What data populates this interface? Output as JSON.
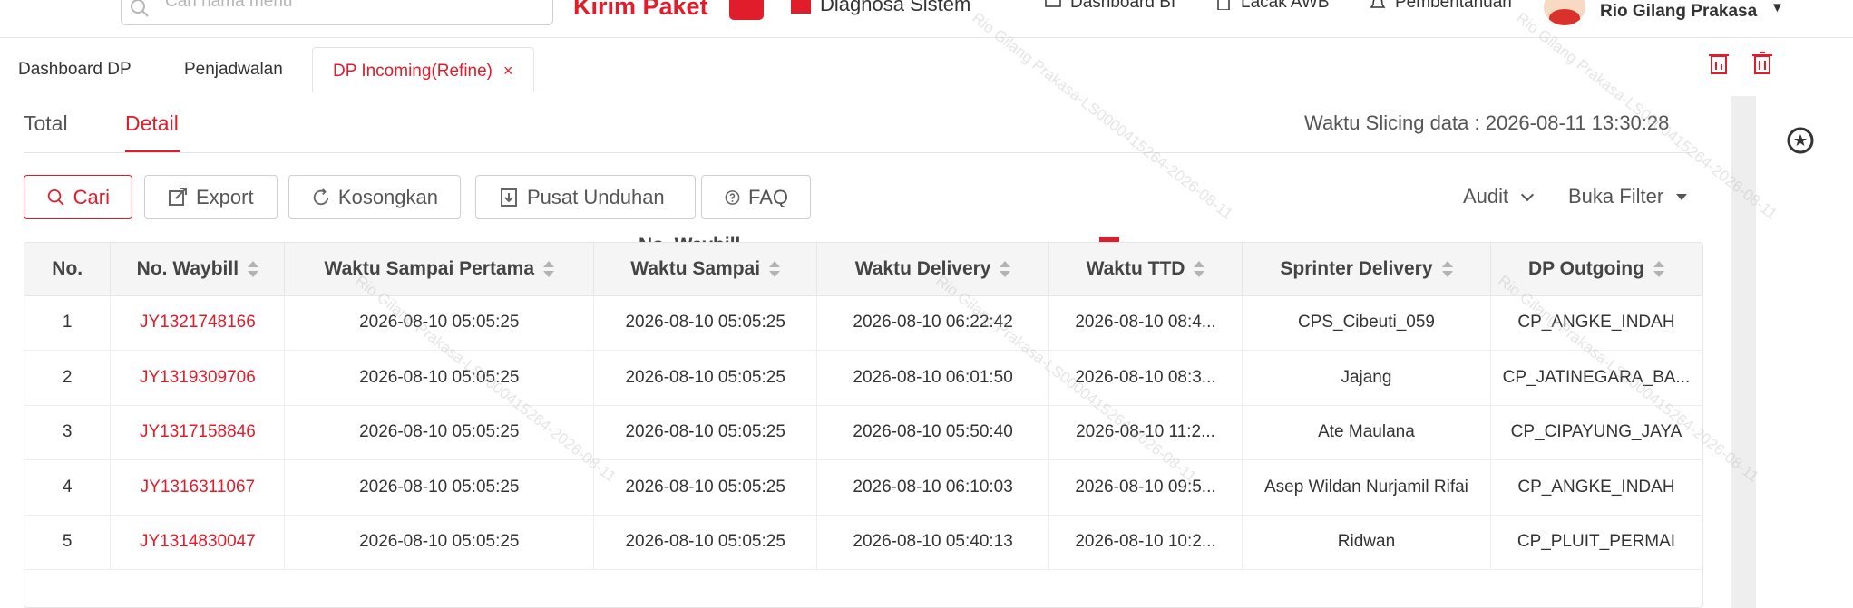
{
  "header": {
    "search_placeholder": "Cari nama menu",
    "brand": "Kirim Paket",
    "nav": [
      "Diagnosa Sistem",
      "Dashboard BI",
      "Lacak AWB",
      "Pemberitahuan"
    ],
    "user_name": "Rio Gilang Prakasa"
  },
  "tabs": [
    {
      "label": "Dashboard DP"
    },
    {
      "label": "Penjadwalan"
    },
    {
      "label": "DP Incoming(Refine)",
      "close": "×"
    }
  ],
  "subtabs": {
    "total": "Total",
    "detail": "Detail"
  },
  "slicing_text": "Waktu Slicing data : 2026-08-11 13:30:28",
  "actions": {
    "search": "Cari",
    "export": "Export",
    "clear": "Kosongkan",
    "download_center": "Pusat Unduhan",
    "faq": "FAQ"
  },
  "dropdowns": {
    "audit": "Audit",
    "filter": "Buka Filter"
  },
  "ghost_header": "No. Waybill",
  "table": {
    "columns": [
      "No.",
      "No. Waybill",
      "Waktu Sampai Pertama",
      "Waktu Sampai",
      "Waktu Delivery",
      "Waktu TTD",
      "Sprinter Delivery",
      "DP Outgoing"
    ],
    "rows": [
      [
        "1",
        "JY1321748166",
        "2026-08-10 05:05:25",
        "2026-08-10 05:05:25",
        "2026-08-10 06:22:42",
        "2026-08-10 08:4...",
        "CPS_Cibeuti_059",
        "CP_ANGKE_INDAH"
      ],
      [
        "2",
        "JY1319309706",
        "2026-08-10 05:05:25",
        "2026-08-10 05:05:25",
        "2026-08-10 06:01:50",
        "2026-08-10 08:3...",
        "Jajang",
        "CP_JATINEGARA_BA..."
      ],
      [
        "3",
        "JY1317158846",
        "2026-08-10 05:05:25",
        "2026-08-10 05:05:25",
        "2026-08-10 05:50:40",
        "2026-08-10 11:2...",
        "Ate Maulana",
        "CP_CIPAYUNG_JAYA"
      ],
      [
        "4",
        "JY1316311067",
        "2026-08-10 05:05:25",
        "2026-08-10 05:05:25",
        "2026-08-10 06:10:03",
        "2026-08-10 09:5...",
        "Asep Wildan Nurjamil Rifai",
        "CP_ANGKE_INDAH"
      ],
      [
        "5",
        "JY1314830047",
        "2026-08-10 05:05:25",
        "2026-08-10 05:05:25",
        "2026-08-10 05:40:13",
        "2026-08-10 10:2...",
        "Ridwan",
        "CP_PLUIT_PERMAI"
      ]
    ]
  },
  "watermark": "Rio Gilang Prakasa-LS0000415264-2026-08-11",
  "colors": {
    "accent": "#e11d2b",
    "header_bg": "#f5f5f6",
    "border": "#e6e6e6"
  }
}
